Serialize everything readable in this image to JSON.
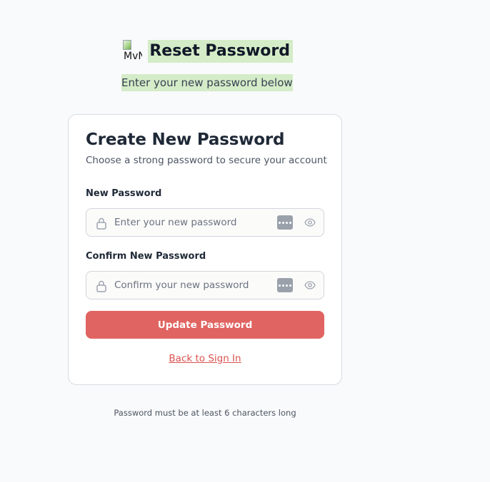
{
  "header": {
    "logo_alt": "MvN",
    "title": "Reset Password",
    "subtitle": "Enter your new password below"
  },
  "card": {
    "title": "Create New Password",
    "description": "Choose a strong password to secure your account",
    "new_password": {
      "label": "New Password",
      "placeholder": "Enter your new password",
      "value": ""
    },
    "confirm_password": {
      "label": "Confirm New Password",
      "placeholder": "Confirm your new password",
      "value": ""
    },
    "submit_label": "Update Password",
    "back_link_label": "Back to Sign In"
  },
  "footer": {
    "note": "Password must be at least 6 characters long"
  },
  "colors": {
    "background": "#f9fafb",
    "highlight": "#d4ecc8",
    "primary_button": "#e06461",
    "link": "#d9534f"
  },
  "icons": {
    "lock": "lock-icon",
    "eye": "eye-icon",
    "password_manager": "password-manager-icon",
    "logo": "broken-image-icon"
  }
}
